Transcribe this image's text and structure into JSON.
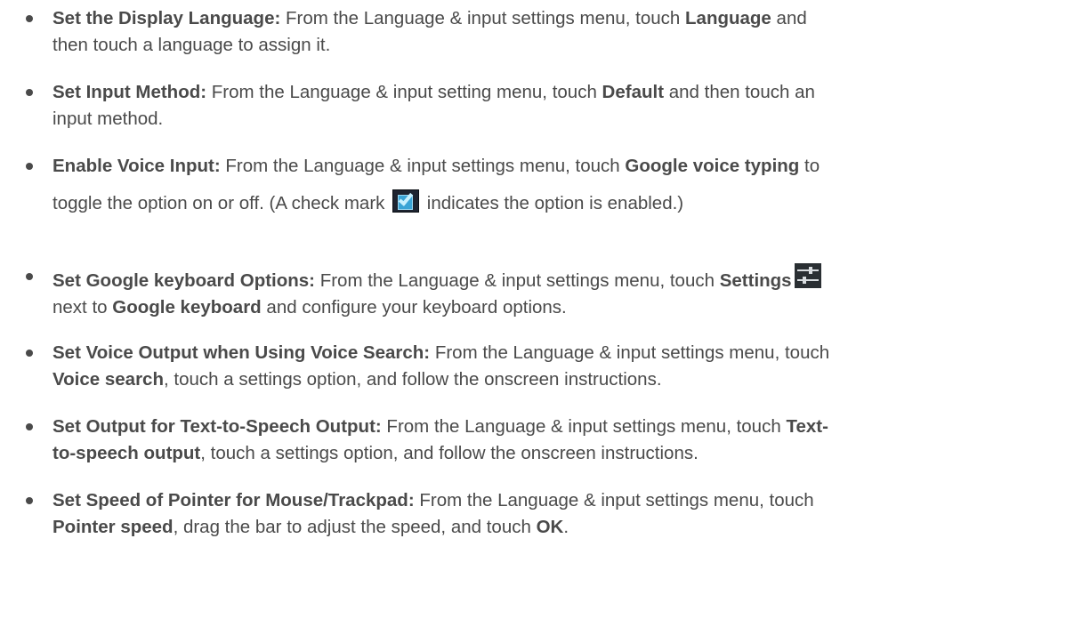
{
  "items": [
    {
      "title": "Set the Display Language:",
      "text1": " From the Language & input settings menu, touch ",
      "b1": "Language",
      "text2": " and",
      "line2": "then touch a language to assign it."
    },
    {
      "title": "Set Input Method:",
      "text1": " From the Language & input setting menu, touch ",
      "b1": "Default",
      "text2": " and then touch an",
      "line2": "input method."
    },
    {
      "title": "Enable Voice Input:",
      "text1": " From the Language & input settings menu, touch ",
      "b1": "Google voice typing",
      "text2": " to",
      "line2a": "toggle the option on or off. (A check mark ",
      "line2b": " indicates the option is enabled.)"
    },
    {
      "title": "Set Google keyboard Options:",
      "text1": " From the Language & input settings menu, touch ",
      "b1": "Settings",
      "line2b1": "next to ",
      "line2bold": "Google keyboard",
      "line2b2": " and configure your keyboard options."
    },
    {
      "title": "Set Voice Output when Using Voice Search:",
      "text1": " From the Language & input settings menu, touch",
      "line2bold": "Voice search",
      "line2rest": ", touch a settings option, and follow the onscreen instructions."
    },
    {
      "title": "Set Output for Text-to-Speech Output:",
      "text1": " From the Language & input settings menu, touch ",
      "b1": "Text-",
      "line2bold": "to-speech output",
      "line2rest": ", touch a settings option, and follow the onscreen instructions."
    },
    {
      "title": "Set Speed of Pointer for Mouse/Trackpad:",
      "text1": " From the Language & input settings menu, touch",
      "line2bold": "Pointer speed",
      "line2rest": ", drag the bar to adjust the speed, and touch ",
      "line2bold2": "OK",
      "line2end": "."
    }
  ],
  "icons": {
    "check_color": "#3aa4d6",
    "settings_bg": "#2a2f33"
  }
}
